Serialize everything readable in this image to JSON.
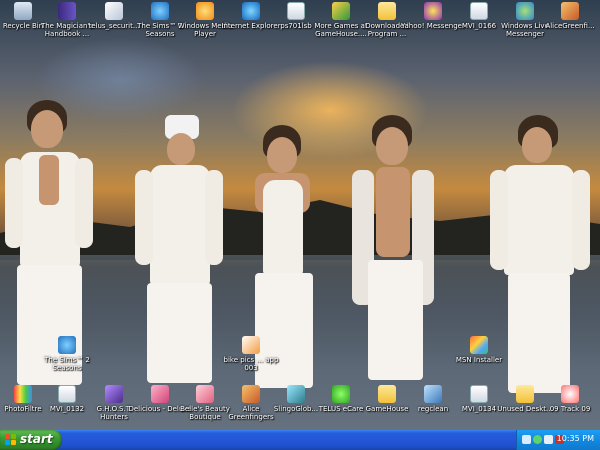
{
  "desktop": {
    "icons_top": [
      {
        "label": "Recycle Bin",
        "icon": "recycle-bin-icon"
      },
      {
        "label": "The Magician's Handbook ...",
        "icon": "book-icon"
      },
      {
        "label": "telus_securit...",
        "icon": "installer-icon"
      },
      {
        "label": "The Sims™ 2 Seasons",
        "icon": "sims-icon"
      },
      {
        "label": "Windows Media Player",
        "icon": "media-player-icon"
      },
      {
        "label": "Internet Explorer",
        "icon": "internet-explorer-icon"
      },
      {
        "label": "ps701lsb",
        "icon": "file-icon"
      },
      {
        "label": "More Games at GameHouse....",
        "icon": "gamehouse-icon"
      },
      {
        "label": "Downloaded Program ...",
        "icon": "folder-icon"
      },
      {
        "label": "Yahoo! Messenger",
        "icon": "yahoo-messenger-icon"
      },
      {
        "label": "MVI_0166",
        "icon": "video-file-icon"
      },
      {
        "label": "Windows Live Messenger",
        "icon": "live-messenger-icon"
      },
      {
        "label": "AliceGreenfi...",
        "icon": "game-icon"
      }
    ],
    "icons_middle": [
      {
        "label": "The Sims™ 2 Seasons",
        "icon": "sims-icon"
      },
      {
        "label": "bike pics ... app 003",
        "icon": "image-file-icon"
      },
      {
        "label": "MSN Installer",
        "icon": "msn-installer-icon"
      }
    ],
    "icons_bottom": [
      {
        "label": "PhotoFiltre",
        "icon": "photofiltre-icon"
      },
      {
        "label": "MVI_0132",
        "icon": "video-file-icon"
      },
      {
        "label": "G.H.O.S.T. Hunters",
        "icon": "game-icon"
      },
      {
        "label": "Delicious - Deluxe",
        "icon": "game-icon"
      },
      {
        "label": "Belle's Beauty Boutique",
        "icon": "game-icon"
      },
      {
        "label": "Alice Greenfingers",
        "icon": "game-icon"
      },
      {
        "label": "SlingoGlob...",
        "icon": "game-icon"
      },
      {
        "label": "TELUS eCare",
        "icon": "telus-icon"
      },
      {
        "label": "GameHouse",
        "icon": "folder-icon"
      },
      {
        "label": "regclean",
        "icon": "registry-icon"
      },
      {
        "label": "MVI_0134",
        "icon": "video-file-icon"
      },
      {
        "label": "Unused Deskt...",
        "icon": "folder-icon"
      },
      {
        "label": "09 Track 09",
        "icon": "audio-file-icon"
      }
    ]
  },
  "taskbar": {
    "start_label": "start",
    "clock": "10:35 PM"
  },
  "colors": {
    "taskbar_blue": "#245edb",
    "start_green": "#3c9a35",
    "tray_blue": "#1289e0"
  }
}
